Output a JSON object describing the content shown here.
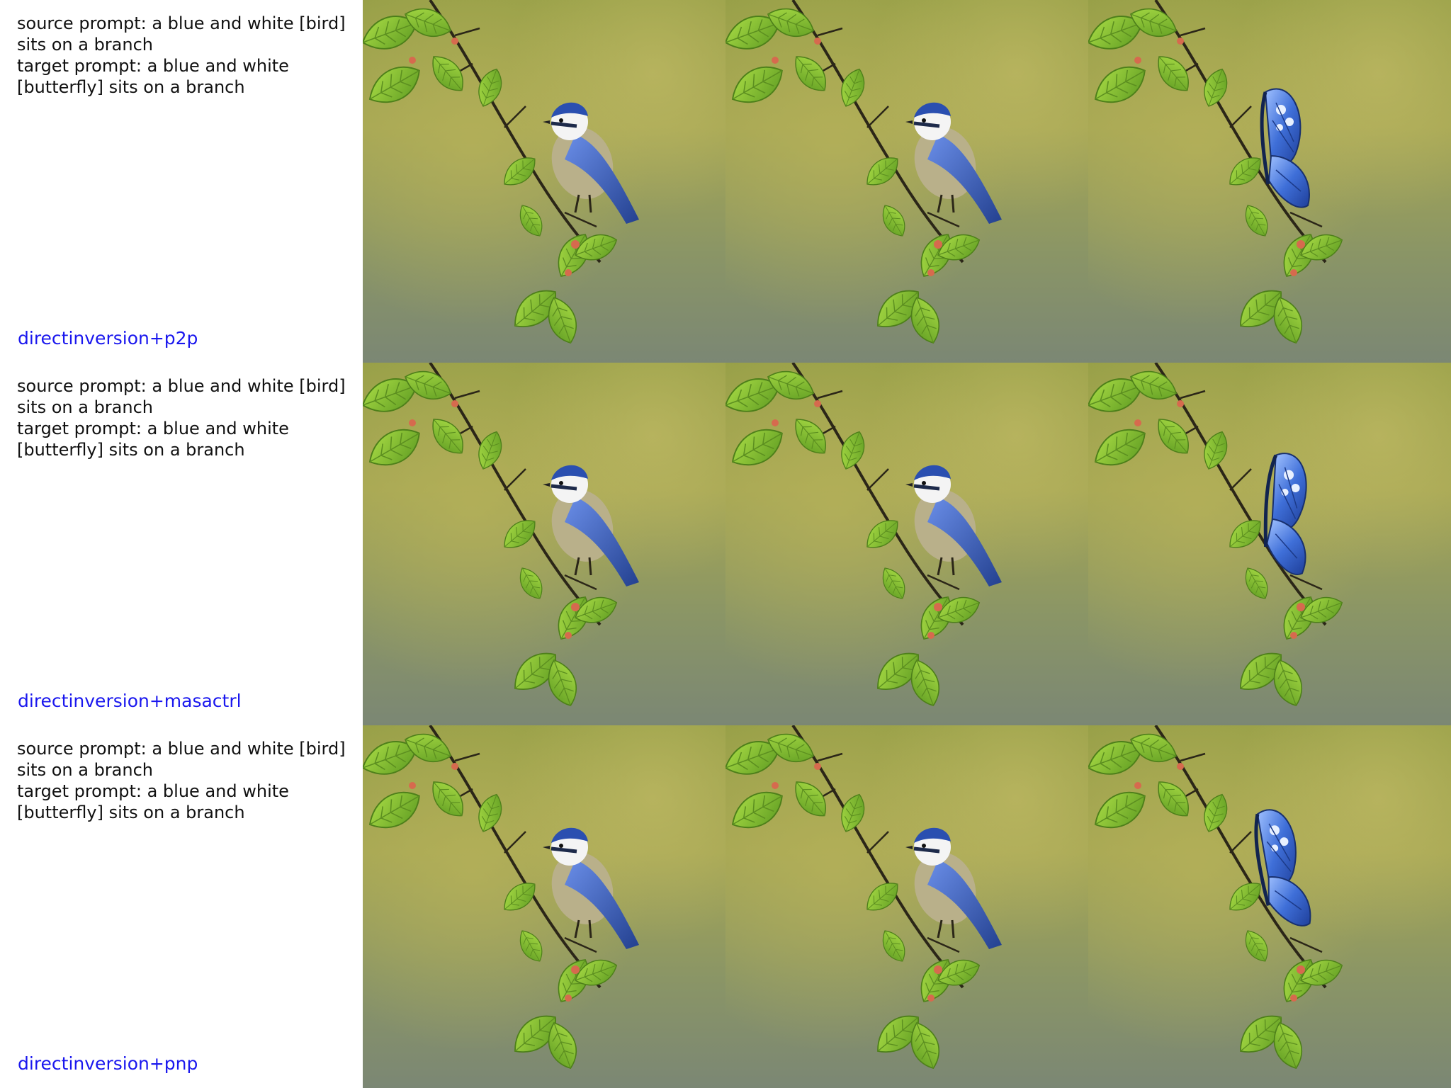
{
  "rows": [
    {
      "source_prompt_line1": "source prompt: a blue and white [bird]",
      "source_prompt_line2": "sits on a branch",
      "target_prompt_line1": "target prompt: a blue and white",
      "target_prompt_line2": "[butterfly] sits on a branch",
      "method": "directinversion+p2p"
    },
    {
      "source_prompt_line1": "source prompt: a blue and white [bird]",
      "source_prompt_line2": "sits on a branch",
      "target_prompt_line1": "target prompt: a blue and white",
      "target_prompt_line2": "[butterfly] sits on a branch",
      "method": "directinversion+masactrl"
    },
    {
      "source_prompt_line1": "source prompt: a blue and white [bird]",
      "source_prompt_line2": "sits on a branch",
      "target_prompt_line1": "target prompt: a blue and white",
      "target_prompt_line2": "[butterfly] sits on a branch",
      "method": "directinversion+pnp"
    }
  ],
  "colors": {
    "method_label": "#1a17ee",
    "prompt_text": "#111111",
    "background_blur_top": "#8f9a4a",
    "background_blur_bottom": "#7c8a70",
    "leaf_green": "#8cc63a",
    "bird_blue": "#2f4fa8",
    "butterfly_blue": "#3f6fd8"
  }
}
